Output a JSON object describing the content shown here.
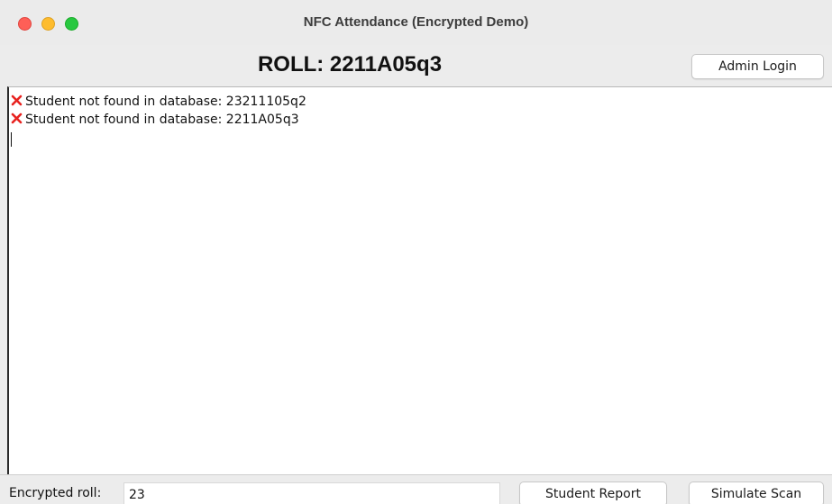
{
  "window": {
    "title": "NFC Attendance (Encrypted Demo)"
  },
  "header": {
    "roll_text": "ROLL: 2211A05q3",
    "admin_button_label": "Admin Login"
  },
  "log": {
    "lines": [
      {
        "icon": "cross-mark-icon",
        "text": "Student not found in database: 23211105q2"
      },
      {
        "icon": "cross-mark-icon",
        "text": "Student not found in database: 2211A05q3"
      }
    ]
  },
  "footer": {
    "encrypted_label": "Encrypted roll:",
    "encrypted_value": "23",
    "student_report_label": "Student Report",
    "simulate_scan_label": "Simulate Scan"
  },
  "colors": {
    "close": "#fe5f57",
    "minimize": "#febc2e",
    "zoom": "#28c840",
    "error_icon": "#e8221f"
  }
}
